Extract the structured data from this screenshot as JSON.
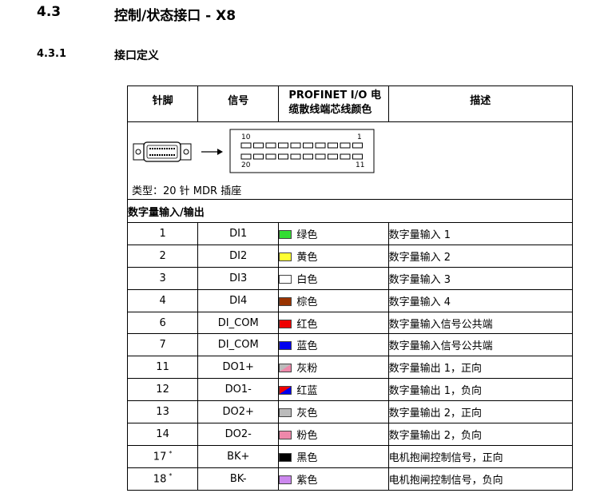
{
  "heading1": {
    "number": "4.3",
    "title": "控制/状态接口 - X8"
  },
  "heading2": {
    "number": "4.3.1",
    "title": "接口定义"
  },
  "table": {
    "headers": {
      "pin": "针脚",
      "signal": "信号",
      "color": "PROFINET I/O 电缆散线端芯线颜色",
      "desc": "描述"
    },
    "connector": {
      "top_left": "10",
      "top_right": "1",
      "bottom_left": "20",
      "bottom_right": "11",
      "type": "类型：20 针 MDR 插座",
      "arrow": "→"
    },
    "section_title": "数字量输入/输出",
    "rows": [
      {
        "pin": "1",
        "signal": "DI1",
        "color_name": "绿色",
        "swatch": "#33dd33",
        "desc": "数字量输入 1"
      },
      {
        "pin": "2",
        "signal": "DI2",
        "color_name": "黄色",
        "swatch": "#ffff33",
        "desc": "数字量输入 2"
      },
      {
        "pin": "3",
        "signal": "DI3",
        "color_name": "白色",
        "swatch": "#ffffff",
        "desc": "数字量输入 3"
      },
      {
        "pin": "4",
        "signal": "DI4",
        "color_name": "棕色",
        "swatch": "#993300",
        "desc": "数字量输入 4"
      },
      {
        "pin": "6",
        "signal": "DI_COM",
        "color_name": "红色",
        "swatch": "#ee0000",
        "desc": "数字量输入信号公共端"
      },
      {
        "pin": "7",
        "signal": "DI_COM",
        "color_name": "蓝色",
        "swatch": "#0000ee",
        "desc": "数字量输入信号公共端"
      },
      {
        "pin": "11",
        "signal": "DO1+",
        "color_name": "灰粉",
        "swatch": "split-gray-pink",
        "desc": "数字量输出 1，正向"
      },
      {
        "pin": "12",
        "signal": "DO1-",
        "color_name": "红蓝",
        "swatch": "split-red-blue",
        "desc": "数字量输出 1，负向"
      },
      {
        "pin": "13",
        "signal": "DO2+",
        "color_name": "灰色",
        "swatch": "#bbbbbb",
        "desc": "数字量输出 2，正向"
      },
      {
        "pin": "14",
        "signal": "DO2-",
        "color_name": "粉色",
        "swatch": "#ee88aa",
        "desc": "数字量输出 2，负向"
      },
      {
        "pin": "17",
        "pin_mark": "*",
        "signal": "BK+",
        "color_name": "黑色",
        "swatch": "#000000",
        "desc": "电机抱闸控制信号，正向"
      },
      {
        "pin": "18",
        "pin_mark": "*",
        "signal": "BK-",
        "color_name": "紫色",
        "swatch": "#cc88ee",
        "desc": "电机抱闸控制信号，负向"
      }
    ]
  }
}
